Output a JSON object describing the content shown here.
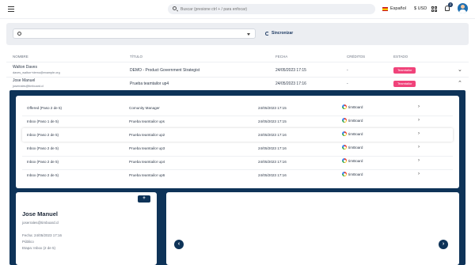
{
  "topbar": {
    "search_placeholder": "Buscar (presione ctrl + / para enfocar)",
    "language": "Español",
    "currency": "$ USD",
    "notification_count": "2"
  },
  "filters": {
    "sync_label": "Sincronizar"
  },
  "table": {
    "headers": {
      "name": "NOMBRE",
      "title": "TÍTULO",
      "date": "FECHA",
      "credits": "CRÉDITOS",
      "status": "ESTADO"
    },
    "rows": [
      {
        "name": "Walton Daves",
        "email": "daves_walton+demo@example.org",
        "title": "DEMO - Product Government Strategist",
        "date": "24/05/2023 17:15",
        "credits": "-",
        "status": "Teamtailor",
        "expanded": false
      },
      {
        "name": "Jose Manuel",
        "email": "joserrales@timboard.cl",
        "title": "Prueba teamtailor up4",
        "date": "24/05/2023 17:16",
        "credits": "-",
        "status": "Teamtailor",
        "expanded": true
      }
    ]
  },
  "applications": [
    {
      "stage": "Offered (Paso 2 de 5)",
      "title": "Comunity Manager",
      "date": "24/05/2023 17:15",
      "source": "timBoard",
      "highlight": false
    },
    {
      "stage": "Inbox (Paso 1 de 5)",
      "title": "Prueba teamtailor ups",
      "date": "24/05/2023 17:15",
      "source": "timBoard",
      "highlight": false
    },
    {
      "stage": "Inbox (Paso 2 de 5)",
      "title": "Prueba teamtailor up2",
      "date": "24/05/2023 17:16",
      "source": "timBoard",
      "highlight": true
    },
    {
      "stage": "Inbox (Paso 2 de 5)",
      "title": "Prueba teamtailor up3",
      "date": "24/05/2023 17:16",
      "source": "timBoard",
      "highlight": false
    },
    {
      "stage": "Inbox (Paso 2 de 5)",
      "title": "Prueba teamtailor up4",
      "date": "24/05/2023 17:16",
      "source": "timBoard",
      "highlight": false
    },
    {
      "stage": "Inbox (Paso 2 de 5)",
      "title": "Prueba teamtailor up6",
      "date": "24/05/2023 17:16",
      "source": "timBoard",
      "highlight": false
    }
  ],
  "candidate": {
    "add_label": "+",
    "name": "Jose Manuel",
    "email": "joserrales@timboard.cl",
    "date_line": "Fecha: 24/05/2023 17:16",
    "visibility": "Público",
    "stage_line": "Etapa: Inbox (2 de 5)"
  },
  "viewer": {
    "prev_label": "‹",
    "next_label": "›"
  },
  "icons": {
    "row_arrow": "›",
    "chevron_down": "⌄",
    "chevron_up": "⌃"
  },
  "colors": {
    "brand_navy": "#0e3358",
    "status_pink": "#f0437a"
  }
}
